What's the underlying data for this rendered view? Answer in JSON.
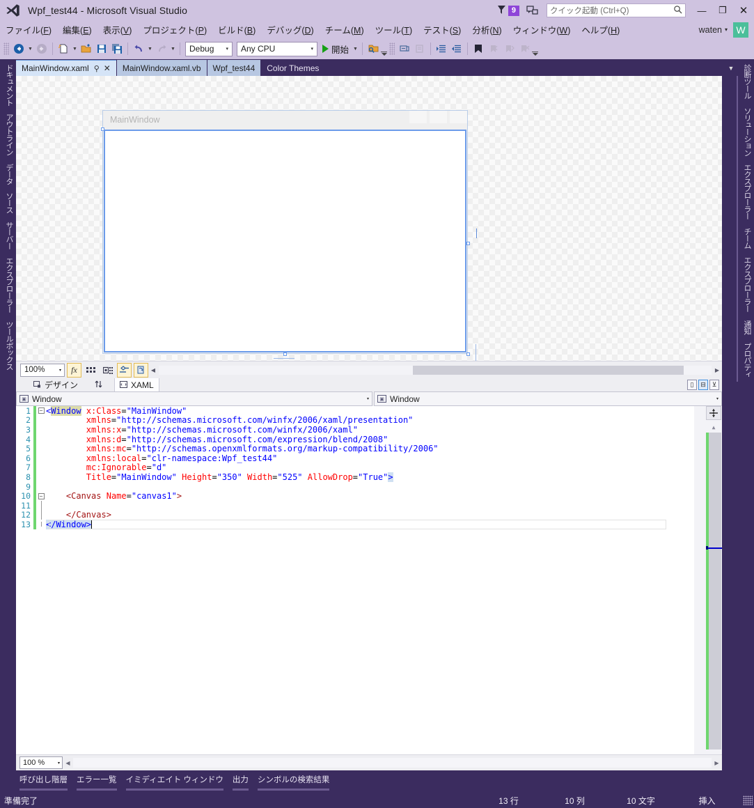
{
  "window": {
    "title": "Wpf_test44 - Microsoft Visual Studio",
    "logo_icon": "visual-studio-logo-icon",
    "minimize_label": "—",
    "maximize_label": "❐",
    "close_label": "✕"
  },
  "titlebar": {
    "notification_icon": "notification-flag-icon",
    "notification_count": "9",
    "feedback_icon": "send-feedback-icon",
    "quick_launch": {
      "placeholder": "クイック起動 (Ctrl+Q)",
      "value": "",
      "search_icon": "search-icon"
    }
  },
  "menubar": {
    "items": [
      {
        "label": "ファイル",
        "accel": "F"
      },
      {
        "label": "編集",
        "accel": "E"
      },
      {
        "label": "表示",
        "accel": "V"
      },
      {
        "label": "プロジェクト",
        "accel": "P"
      },
      {
        "label": "ビルド",
        "accel": "B"
      },
      {
        "label": "デバッグ",
        "accel": "D"
      },
      {
        "label": "チーム",
        "accel": "M"
      },
      {
        "label": "ツール",
        "accel": "T"
      },
      {
        "label": "テスト",
        "accel": "S"
      },
      {
        "label": "分析",
        "accel": "N"
      },
      {
        "label": "ウィンドウ",
        "accel": "W"
      },
      {
        "label": "ヘルプ",
        "accel": "H"
      }
    ],
    "account": {
      "user": "waten",
      "caret": "▾",
      "avatar_letter": "W",
      "avatar_color": "#4bbf9a"
    }
  },
  "toolbar": {
    "icons": [
      "navigate-backward-icon",
      "navigate-forward-icon",
      "new-project-icon",
      "open-file-icon",
      "save-icon",
      "save-all-icon",
      "undo-icon",
      "redo-icon"
    ],
    "configuration": {
      "value": "Debug",
      "arrow": "▾"
    },
    "platform": {
      "value": "Any CPU",
      "arrow": "▾"
    },
    "start_label": "開始",
    "start_icon": "play-icon",
    "right_icons": [
      "find-in-files-icon",
      "comment-icon",
      "uncomment-icon",
      "indent-icon",
      "outdent-icon",
      "bookmark-icon",
      "prev-bookmark-icon",
      "next-bookmark-icon",
      "clear-bookmarks-icon"
    ]
  },
  "left_dock": {
    "items": [
      "ドキュメント アウトライン",
      "データ ソース",
      "サーバー エクスプローラー",
      "ツールボックス"
    ]
  },
  "right_dock": {
    "items": [
      "診断ツール",
      "ソリューション エクスプローラー",
      "チーム エクスプローラー",
      "通知",
      "プロパティ"
    ]
  },
  "document_tabs": {
    "tabs": [
      {
        "label": "MainWindow.xaml",
        "state": "active",
        "pin_icon": "pin-icon",
        "close_icon": "close-icon"
      },
      {
        "label": "MainWindow.xaml.vb",
        "state": "inactive"
      },
      {
        "label": "Wpf_test44",
        "state": "inactive"
      },
      {
        "label": "Color Themes",
        "state": "background"
      }
    ],
    "overflow_icon": "chevron-down-icon"
  },
  "designer": {
    "preview_title": "MainWindow",
    "preview_width": 525,
    "preview_height": 350,
    "chrome_icons": [
      "minimize-icon",
      "maximize-icon",
      "close-icon"
    ],
    "selection": "canvas1",
    "toolbar": {
      "zoom": {
        "value": "100%",
        "arrow": "▾"
      },
      "buttons": [
        {
          "name": "effects-toggle",
          "glyph": "fx",
          "active": true
        },
        {
          "name": "grid-toggle",
          "glyph": "▓",
          "active": false
        },
        {
          "name": "snap-toggle",
          "glyph": "❖",
          "active": false
        },
        {
          "name": "artboard-toggle",
          "glyph": "✤",
          "active": true
        },
        {
          "name": "refresh-designer",
          "glyph": "↻",
          "active": true
        }
      ],
      "scroll_left_icon": "chevron-left-icon",
      "scroll_right_icon": "chevron-right-icon"
    },
    "view_tabs": [
      {
        "label": "デザイン",
        "icon": "design-view-icon",
        "active": false
      },
      {
        "label": "XAML",
        "icon": "xaml-view-icon",
        "active": true
      }
    ],
    "swap_icon": "swap-panes-icon",
    "layout_buttons": [
      "split-vertical-icon",
      "split-horizontal-icon",
      "collapse-pane-icon"
    ]
  },
  "navbars": {
    "left": {
      "value": "Window",
      "icon": "class-icon",
      "arrow": "▾"
    },
    "right": {
      "value": "Window",
      "icon": "member-icon",
      "arrow": "▾"
    }
  },
  "editor": {
    "language": "xaml",
    "lines": [
      {
        "n": 1,
        "fold": "open",
        "changed": true,
        "tokens": [
          {
            "t": "<",
            "c": "tag2"
          },
          {
            "t": "Window",
            "c": "hl"
          },
          {
            "t": " ",
            "c": "plain"
          },
          {
            "t": "x:Class",
            "c": "attr"
          },
          {
            "t": "=",
            "c": "plain"
          },
          {
            "t": "\"MainWindow\"",
            "c": "val"
          }
        ]
      },
      {
        "n": 2,
        "fold": "none",
        "changed": true,
        "tokens": [
          {
            "t": "        ",
            "c": "plain"
          },
          {
            "t": "xmlns",
            "c": "attr"
          },
          {
            "t": "=",
            "c": "plain"
          },
          {
            "t": "\"http://schemas.microsoft.com/winfx/2006/xaml/presentation\"",
            "c": "val"
          }
        ]
      },
      {
        "n": 3,
        "fold": "none",
        "changed": true,
        "tokens": [
          {
            "t": "        ",
            "c": "plain"
          },
          {
            "t": "xmlns:x",
            "c": "attr"
          },
          {
            "t": "=",
            "c": "plain"
          },
          {
            "t": "\"http://schemas.microsoft.com/winfx/2006/xaml\"",
            "c": "val"
          }
        ]
      },
      {
        "n": 4,
        "fold": "none",
        "changed": true,
        "tokens": [
          {
            "t": "        ",
            "c": "plain"
          },
          {
            "t": "xmlns:d",
            "c": "attr"
          },
          {
            "t": "=",
            "c": "plain"
          },
          {
            "t": "\"http://schemas.microsoft.com/expression/blend/2008\"",
            "c": "val"
          }
        ]
      },
      {
        "n": 5,
        "fold": "none",
        "changed": true,
        "tokens": [
          {
            "t": "        ",
            "c": "plain"
          },
          {
            "t": "xmlns:mc",
            "c": "attr"
          },
          {
            "t": "=",
            "c": "plain"
          },
          {
            "t": "\"http://schemas.openxmlformats.org/markup-compatibility/2006\"",
            "c": "val"
          }
        ]
      },
      {
        "n": 6,
        "fold": "none",
        "changed": true,
        "tokens": [
          {
            "t": "        ",
            "c": "plain"
          },
          {
            "t": "xmlns:local",
            "c": "attr"
          },
          {
            "t": "=",
            "c": "plain"
          },
          {
            "t": "\"clr-namespace:Wpf_test44\"",
            "c": "val"
          }
        ]
      },
      {
        "n": 7,
        "fold": "none",
        "changed": true,
        "tokens": [
          {
            "t": "        ",
            "c": "plain"
          },
          {
            "t": "mc:Ignorable",
            "c": "attr"
          },
          {
            "t": "=",
            "c": "plain"
          },
          {
            "t": "\"d\"",
            "c": "val"
          }
        ]
      },
      {
        "n": 8,
        "fold": "none",
        "changed": true,
        "tokens": [
          {
            "t": "        ",
            "c": "plain"
          },
          {
            "t": "Title",
            "c": "attr"
          },
          {
            "t": "=",
            "c": "plain"
          },
          {
            "t": "\"MainWindow\"",
            "c": "val"
          },
          {
            "t": " ",
            "c": "plain"
          },
          {
            "t": "Height",
            "c": "attr"
          },
          {
            "t": "=",
            "c": "plain"
          },
          {
            "t": "\"350\"",
            "c": "val"
          },
          {
            "t": " ",
            "c": "plain"
          },
          {
            "t": "Width",
            "c": "attr"
          },
          {
            "t": "=",
            "c": "plain"
          },
          {
            "t": "\"525\"",
            "c": "val"
          },
          {
            "t": " ",
            "c": "plain"
          },
          {
            "t": "AllowDrop",
            "c": "attr"
          },
          {
            "t": "=",
            "c": "plain"
          },
          {
            "t": "\"True\"",
            "c": "val"
          },
          {
            "t": ">",
            "c": "selbrace"
          }
        ]
      },
      {
        "n": 9,
        "fold": "none",
        "changed": true,
        "tokens": []
      },
      {
        "n": 10,
        "fold": "open",
        "changed": true,
        "tokens": [
          {
            "t": "    ",
            "c": "plain"
          },
          {
            "t": "<Canvas",
            "c": "tag"
          },
          {
            "t": " ",
            "c": "plain"
          },
          {
            "t": "Name",
            "c": "attr"
          },
          {
            "t": "=",
            "c": "plain"
          },
          {
            "t": "\"canvas1\"",
            "c": "val"
          },
          {
            "t": ">",
            "c": "tag"
          }
        ]
      },
      {
        "n": 11,
        "fold": "bar",
        "changed": true,
        "tokens": []
      },
      {
        "n": 12,
        "fold": "bar",
        "changed": true,
        "tokens": [
          {
            "t": "    ",
            "c": "plain"
          },
          {
            "t": "</Canvas>",
            "c": "tag"
          }
        ]
      },
      {
        "n": 13,
        "fold": "end",
        "changed": true,
        "cursor": true,
        "tokens": [
          {
            "t": "</Window>",
            "c": "selbrace"
          }
        ]
      }
    ],
    "zoom": {
      "value": "100 %",
      "arrow": "▾"
    },
    "scroll_left_icon": "chevron-left-icon",
    "scroll_right_icon": "chevron-right-icon",
    "split_icon": "split-editor-icon",
    "up_icon": "scroll-up-icon"
  },
  "bottom_tabs": {
    "items": [
      "呼び出し階層",
      "エラー一覧",
      "イミディエイト ウィンドウ",
      "出力",
      "シンボルの検索結果"
    ]
  },
  "statusbar": {
    "status": "準備完了",
    "line": "13 行",
    "column": "10 列",
    "character": "10 文字",
    "insert_mode": "挿入"
  },
  "colors": {
    "chrome": "#cfc3e0",
    "dark_purple": "#3b2c5f",
    "accent_blue": "#6b9bea",
    "tab_active": "#d5e4f7",
    "tab_inactive": "#b7c7e2",
    "badge_purple": "#8e44d8",
    "change_bar_green": "#6fd66f",
    "editor_bg": "#ffffff"
  }
}
